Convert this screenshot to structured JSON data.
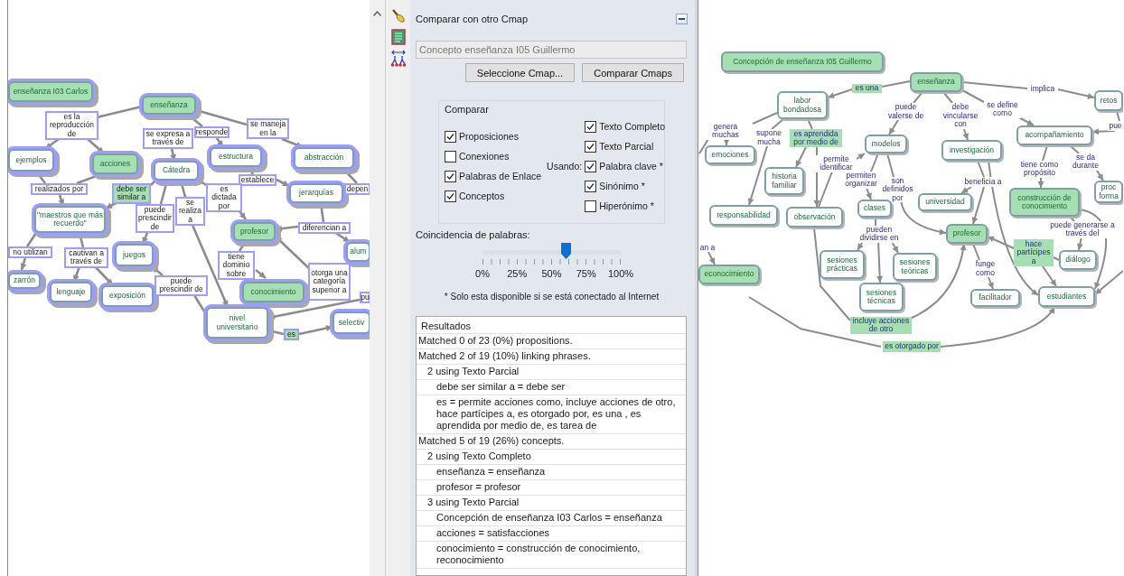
{
  "left_map": {
    "highlighted": true,
    "nodes": [
      {
        "text": "enseñanza I03 Carlos",
        "kind": "concept",
        "matched": true
      },
      {
        "text": "enseñanza",
        "kind": "concept",
        "matched": true
      },
      {
        "text": "es la reproducción de",
        "kind": "linking",
        "matched": false
      },
      {
        "text": "se expresa a través de",
        "kind": "linking",
        "matched": false
      },
      {
        "text": "responde",
        "kind": "linking",
        "matched": false
      },
      {
        "text": "se maneja en la",
        "kind": "linking",
        "matched": false
      },
      {
        "text": "ejemplos",
        "kind": "concept",
        "matched": false
      },
      {
        "text": "acciones",
        "kind": "concept",
        "matched": true
      },
      {
        "text": "Cátedra",
        "kind": "concept",
        "matched": false
      },
      {
        "text": "estructura",
        "kind": "concept",
        "matched": false
      },
      {
        "text": "abstracción",
        "kind": "concept",
        "matched": false
      },
      {
        "text": "establece",
        "kind": "linking",
        "matched": false
      },
      {
        "text": "realizados por",
        "kind": "linking",
        "matched": false
      },
      {
        "text": "debe ser similar a",
        "kind": "linking",
        "matched": true
      },
      {
        "text": "es dictada por",
        "kind": "linking",
        "matched": false
      },
      {
        "text": "jerarquías",
        "kind": "concept",
        "matched": false
      },
      {
        "text": "depen",
        "kind": "linking",
        "matched": false
      },
      {
        "text": "\"maestros que más recuerdo\"",
        "kind": "concept",
        "matched": false
      },
      {
        "text": "puede prescindir de",
        "kind": "linking",
        "matched": false
      },
      {
        "text": "se realiza a",
        "kind": "linking",
        "matched": false
      },
      {
        "text": "profesor",
        "kind": "concept",
        "matched": true
      },
      {
        "text": "diferencian a",
        "kind": "linking",
        "matched": false
      },
      {
        "text": "no utilizan",
        "kind": "linking",
        "matched": false
      },
      {
        "text": "cautivan a través de",
        "kind": "linking",
        "matched": false
      },
      {
        "text": "juegos",
        "kind": "concept",
        "matched": false
      },
      {
        "text": "tiene dominio sobre",
        "kind": "linking",
        "matched": false
      },
      {
        "text": "alum",
        "kind": "concept",
        "matched": false
      },
      {
        "text": "zarrón",
        "kind": "concept",
        "matched": false
      },
      {
        "text": "lenguaje",
        "kind": "concept",
        "matched": false
      },
      {
        "text": "exposición",
        "kind": "concept",
        "matched": false
      },
      {
        "text": "puede prescindir de",
        "kind": "linking",
        "matched": false
      },
      {
        "text": "conocimiento",
        "kind": "concept",
        "matched": true
      },
      {
        "text": "otorga una categoría superior a",
        "kind": "linking",
        "matched": false
      },
      {
        "text": "pu",
        "kind": "linking",
        "matched": false
      },
      {
        "text": "nivel universitario",
        "kind": "concept",
        "matched": false
      },
      {
        "text": "es",
        "kind": "linking",
        "matched": true
      },
      {
        "text": "selectiv",
        "kind": "concept",
        "matched": false
      }
    ]
  },
  "panel": {
    "title": "Comparar con otro Cmap",
    "source_field": {
      "value": "Concepto enseñanza I05 Guillermo",
      "disabled": true
    },
    "buttons": [
      "Seleccione Cmap...",
      "Comparar Cmaps"
    ],
    "compare_group": {
      "legend": "Comparar",
      "options": [
        {
          "label": "Proposiciones",
          "checked": true
        },
        {
          "label": "Conexiones",
          "checked": false
        },
        {
          "label": "Palabras de Enlace",
          "checked": true
        },
        {
          "label": "Conceptos",
          "checked": true
        }
      ],
      "using_label": "Usando:",
      "using_options": [
        {
          "label": "Texto Completo",
          "checked": true
        },
        {
          "label": "Texto Parcial",
          "checked": true
        },
        {
          "label": "Palabra clave *",
          "checked": true
        },
        {
          "label": "Sinónimo *",
          "checked": true
        },
        {
          "label": "Hiperónimo *",
          "checked": false
        }
      ]
    },
    "match_slider": {
      "label": "Coincidencia de palabras:",
      "level": 0.6,
      "ticks": [
        "0%",
        "25%",
        "50%",
        "75%",
        "100%"
      ]
    },
    "note": "* Solo esta disponible si se está conectado al Internet",
    "results": {
      "title": "Resultados",
      "items": [
        {
          "text": "Matched 0 of 23 (0%) propositions."
        },
        {
          "text": "Matched 2 of 19 (10%) linking phrases.",
          "children": [
            {
              "text": "2 using Texto Parcial",
              "children": [
                {
                  "text": "debe ser similar a = debe ser"
                },
                {
                  "text": "es = permite acciones como, incluye acciones de otro, hace partícipes a, es otorgado por, es una , es aprendida por medio de, es tarea de"
                }
              ]
            }
          ]
        },
        {
          "text": "Matched 5 of 19 (26%) concepts.",
          "children": [
            {
              "text": "2 using Texto Completo",
              "children": [
                {
                  "text": "enseñanza = enseñanza"
                },
                {
                  "text": "profesor = profesor"
                }
              ]
            },
            {
              "text": "3 using Texto Parcial",
              "children": [
                {
                  "text": "Concepción de enseñanza I03 Carlos = enseñanza"
                },
                {
                  "text": "acciones = satisfacciones"
                },
                {
                  "text": "conocimiento = construcción de conocimiento, reconocimiento"
                }
              ]
            }
          ]
        }
      ]
    }
  },
  "right_map": {
    "highlighted": false,
    "nodes": [
      {
        "text": "Concepción de enseñanza I05 Guillermo",
        "kind": "concept",
        "matched": true
      },
      {
        "text": "es una",
        "kind": "linking",
        "matched": true
      },
      {
        "text": "enseñanza",
        "kind": "concept",
        "matched": true
      },
      {
        "text": "implica",
        "kind": "linking",
        "matched": false
      },
      {
        "text": "labor bondadosa",
        "kind": "concept",
        "matched": false
      },
      {
        "text": "puede valerse de",
        "kind": "linking",
        "matched": false
      },
      {
        "text": "debe vincularse con",
        "kind": "linking",
        "matched": false
      },
      {
        "text": "se define como",
        "kind": "linking",
        "matched": false
      },
      {
        "text": "retos",
        "kind": "concept",
        "matched": false
      },
      {
        "text": "genera muchas",
        "kind": "linking",
        "matched": false
      },
      {
        "text": "supone mucha",
        "kind": "linking",
        "matched": false
      },
      {
        "text": "es aprendida por medio de",
        "kind": "linking",
        "matched": true
      },
      {
        "text": "modelos",
        "kind": "concept",
        "matched": false
      },
      {
        "text": "acompañamiento",
        "kind": "concept",
        "matched": false
      },
      {
        "text": "pue",
        "kind": "linking",
        "matched": false
      },
      {
        "text": "emociones",
        "kind": "concept",
        "matched": false
      },
      {
        "text": "investigación",
        "kind": "concept",
        "matched": false
      },
      {
        "text": "permite identificar",
        "kind": "linking",
        "matched": false
      },
      {
        "text": "tiene como propósito",
        "kind": "linking",
        "matched": false
      },
      {
        "text": "se da durante",
        "kind": "linking",
        "matched": false
      },
      {
        "text": "historia familiar",
        "kind": "concept",
        "matched": false
      },
      {
        "text": "permiten organizar",
        "kind": "linking",
        "matched": false
      },
      {
        "text": "son definidos por",
        "kind": "linking",
        "matched": false
      },
      {
        "text": "beneficia a",
        "kind": "linking",
        "matched": false
      },
      {
        "text": "responsabilidad",
        "kind": "concept",
        "matched": false
      },
      {
        "text": "observación",
        "kind": "concept",
        "matched": false
      },
      {
        "text": "clases",
        "kind": "concept",
        "matched": false
      },
      {
        "text": "universidad",
        "kind": "concept",
        "matched": false
      },
      {
        "text": "construcción de conocimiento",
        "kind": "concept",
        "matched": true
      },
      {
        "text": "proc forma",
        "kind": "concept",
        "matched": false
      },
      {
        "text": "pueden dividirse en",
        "kind": "linking",
        "matched": false
      },
      {
        "text": "profesor",
        "kind": "concept",
        "matched": true
      },
      {
        "text": "puede generarse a través del",
        "kind": "linking",
        "matched": false
      },
      {
        "text": "an a",
        "kind": "linking",
        "matched": false
      },
      {
        "text": "econocimiento",
        "kind": "concept",
        "matched": true
      },
      {
        "text": "sesiones prácticas",
        "kind": "concept",
        "matched": false
      },
      {
        "text": "sesiones teóricas",
        "kind": "concept",
        "matched": false
      },
      {
        "text": "funge como",
        "kind": "linking",
        "matched": false
      },
      {
        "text": "hace partícipes a",
        "kind": "linking",
        "matched": true
      },
      {
        "text": "diálogo",
        "kind": "concept",
        "matched": false
      },
      {
        "text": "sesiones técnicas",
        "kind": "concept",
        "matched": false
      },
      {
        "text": "facilitador",
        "kind": "concept",
        "matched": false
      },
      {
        "text": "estudiantes",
        "kind": "concept",
        "matched": false
      },
      {
        "text": "incluye acciones de otro",
        "kind": "linking",
        "matched": true
      },
      {
        "text": "es otorgado por",
        "kind": "linking",
        "matched": true
      }
    ]
  }
}
